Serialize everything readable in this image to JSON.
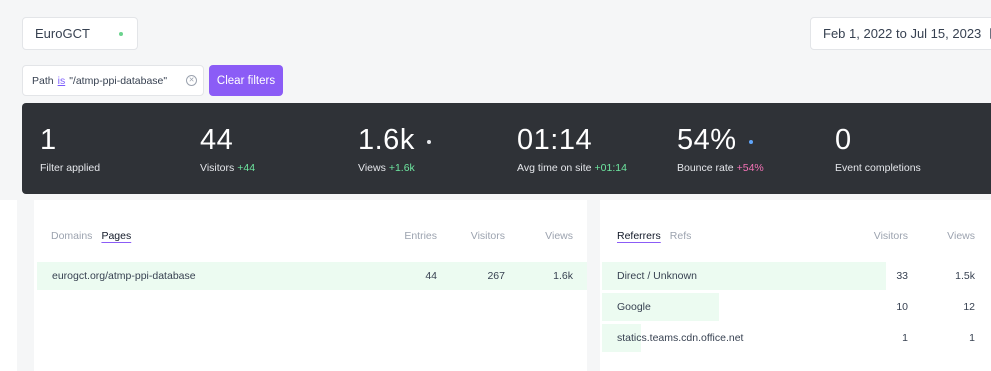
{
  "site": {
    "name": "EuroGCT"
  },
  "date_range": {
    "label": "Feb 1, 2022 to Jul 15, 2023"
  },
  "filter": {
    "field": "Path",
    "operator": "is",
    "value": "\"/atmp-ppi-database\""
  },
  "clear_filters_label": "Clear filters",
  "stats": [
    {
      "value": "1",
      "label": "Filter applied",
      "delta": ""
    },
    {
      "value": "44",
      "label": "Visitors",
      "delta": "+44"
    },
    {
      "value": "1.6k",
      "label": "Views",
      "delta": "+1.6k"
    },
    {
      "value": "01:14",
      "label": "Avg time on site",
      "delta": "+01:14"
    },
    {
      "value": "54%",
      "label": "Bounce rate",
      "delta": "+54%"
    },
    {
      "value": "0",
      "label": "Event completions",
      "delta": ""
    }
  ],
  "pages_panel": {
    "tabs": [
      "Domains",
      "Pages"
    ],
    "active_tab": "Pages",
    "columns": [
      "Entries",
      "Visitors",
      "Views"
    ],
    "rows": [
      {
        "name": "eurogct.org/atmp-ppi-database",
        "entries": "44",
        "visitors": "267",
        "views": "1.6k",
        "share": 1.0
      }
    ]
  },
  "referrers_panel": {
    "tabs": [
      "Referrers",
      "Refs"
    ],
    "active_tab": "Referrers",
    "columns": [
      "Visitors",
      "Views"
    ],
    "rows": [
      {
        "name": "Direct / Unknown",
        "visitors": "33",
        "views": "1.5k",
        "share": 0.73
      },
      {
        "name": "Google",
        "visitors": "10",
        "views": "12",
        "share": 0.3
      },
      {
        "name": "statics.teams.cdn.office.net",
        "visitors": "1",
        "views": "1",
        "share": 0.1
      }
    ]
  },
  "colors": {
    "accent": "#8b5cf6",
    "positive": "#6ee7a0",
    "negative": "#f472b6",
    "bar": "#ecfbf1",
    "stats_bg": "#2f3237"
  }
}
